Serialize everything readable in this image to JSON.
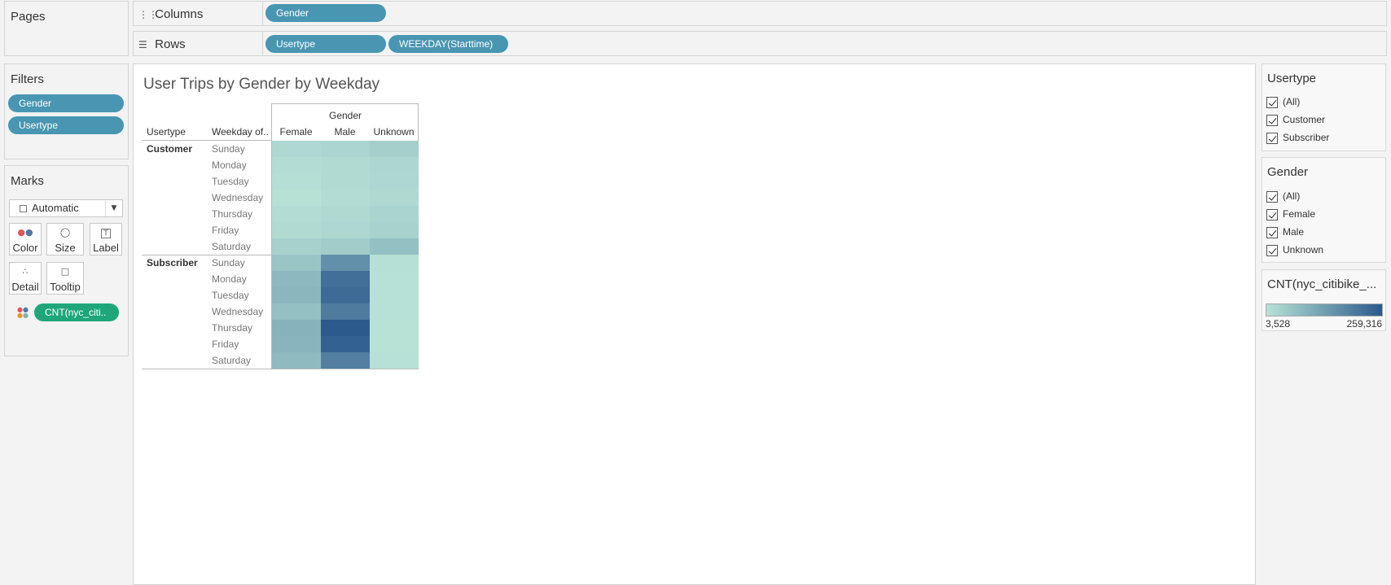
{
  "pages": {
    "title": "Pages"
  },
  "columns_shelf": {
    "label": "Columns",
    "icon": "columns-icon",
    "pills": [
      "Gender"
    ]
  },
  "rows_shelf": {
    "label": "Rows",
    "icon": "rows-icon",
    "pills": [
      "Usertype",
      "WEEKDAY(Starttime)"
    ]
  },
  "filters": {
    "title": "Filters",
    "pills": [
      "Gender",
      "Usertype"
    ]
  },
  "marks": {
    "title": "Marks",
    "mark_type": "Automatic",
    "buttons": [
      {
        "label": "Color",
        "icon": "color-icon"
      },
      {
        "label": "Size",
        "icon": "size-icon"
      },
      {
        "label": "Label",
        "icon": "label-icon"
      },
      {
        "label": "Detail",
        "icon": "detail-icon"
      },
      {
        "label": "Tooltip",
        "icon": "tooltip-icon"
      }
    ],
    "measure_pill": "CNT(nyc_citi.."
  },
  "view": {
    "title": "User Trips by Gender by Weekday",
    "column_header_title": "Gender",
    "row_header_usertype": "Usertype",
    "row_header_weekday": "Weekday of..",
    "columns": [
      "Female",
      "Male",
      "Unknown"
    ],
    "groups": [
      {
        "name": "Customer",
        "days": [
          "Sunday",
          "Monday",
          "Tuesday",
          "Wednesday",
          "Thursday",
          "Friday",
          "Saturday"
        ]
      },
      {
        "name": "Subscriber",
        "days": [
          "Sunday",
          "Monday",
          "Tuesday",
          "Wednesday",
          "Thursday",
          "Friday",
          "Saturday"
        ]
      }
    ]
  },
  "usertype_filter": {
    "title": "Usertype",
    "options": [
      "(All)",
      "Customer",
      "Subscriber"
    ]
  },
  "gender_filter": {
    "title": "Gender",
    "options": [
      "(All)",
      "Female",
      "Male",
      "Unknown"
    ]
  },
  "legend": {
    "title": "CNT(nyc_citibike_...",
    "min_label": "3,528",
    "max_label": "259,316",
    "color_low": "#b8e2d6",
    "color_high": "#2c5a8c"
  },
  "chart_data": {
    "type": "heatmap",
    "title": "User Trips by Gender by Weekday",
    "x_categories": [
      "Female",
      "Male",
      "Unknown"
    ],
    "y_groups": [
      "Customer",
      "Subscriber"
    ],
    "y_categories": [
      "Sunday",
      "Monday",
      "Tuesday",
      "Wednesday",
      "Thursday",
      "Friday",
      "Saturday"
    ],
    "value_range": [
      3528,
      259316
    ],
    "values": {
      "Customer": [
        [
          22000,
          28000,
          40000
        ],
        [
          12000,
          18000,
          26000
        ],
        [
          9000,
          16000,
          24000
        ],
        [
          6000,
          12000,
          20000
        ],
        [
          12000,
          20000,
          30000
        ],
        [
          16000,
          24000,
          34000
        ],
        [
          36000,
          44000,
          70000
        ]
      ],
      "Subscriber": [
        [
          58000,
          160000,
          8000
        ],
        [
          82000,
          220000,
          5000
        ],
        [
          86000,
          228000,
          5000
        ],
        [
          70000,
          196000,
          4500
        ],
        [
          94000,
          259316,
          4000
        ],
        [
          90000,
          244000,
          3528
        ],
        [
          78000,
          190000,
          5000
        ]
      ]
    }
  }
}
